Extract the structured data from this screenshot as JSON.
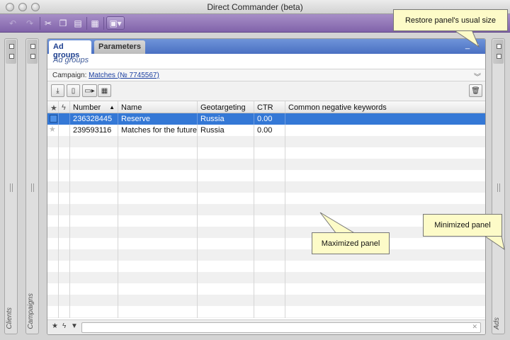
{
  "window": {
    "title": "Direct Commander (beta)"
  },
  "toolbar": {
    "icons": [
      "undo-icon",
      "redo-icon",
      "cut-icon",
      "copy-icon",
      "paste-icon",
      "table-icon",
      "dropdown-icon"
    ]
  },
  "side_panels": {
    "left1": "Clients",
    "left2": "Campaigns",
    "right": "Ads"
  },
  "panel": {
    "tabs": [
      {
        "label": "Ad groups",
        "active": true
      },
      {
        "label": "Parameters",
        "active": false
      }
    ],
    "subtitle": "Ad groups",
    "campaign_label": "Campaign:",
    "campaign_link": "Matches (№ 7745567)"
  },
  "grid": {
    "columns": [
      "",
      "",
      "Number",
      "Name",
      "Geotargeting",
      "CTR",
      "Common negative keywords"
    ],
    "sort_indicator": "▲",
    "rows": [
      {
        "number": "236328445",
        "name": "Reserve",
        "geo": "Russia",
        "ctr": "0.00",
        "keywords": "",
        "selected": true
      },
      {
        "number": "239593116",
        "name": "Matches for the future",
        "geo": "Russia",
        "ctr": "0.00",
        "keywords": "",
        "selected": false
      }
    ]
  },
  "callouts": {
    "restore": "Restore panel's usual size",
    "maximized": "Maximized panel",
    "minimized": "Minimized panel"
  },
  "colors": {
    "toolbar": "#8163aa",
    "tabbar": "#4a70c2",
    "selection": "#3478d6",
    "callout": "#fdfbc8"
  }
}
